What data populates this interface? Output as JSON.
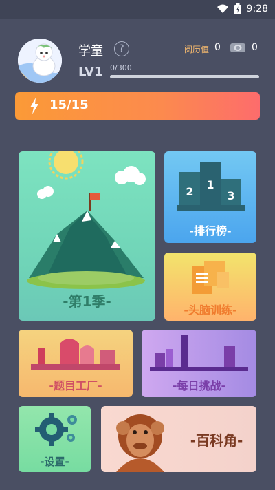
{
  "status_bar": {
    "time": "9:28"
  },
  "profile": {
    "name": "学童",
    "help_symbol": "?",
    "experience_label": "阅历值",
    "experience_value": "0",
    "coins_value": "0",
    "level": "LV1",
    "exp_text": "0/300",
    "exp_progress": 0
  },
  "energy": {
    "text": "15/15"
  },
  "cards": {
    "season": {
      "label": "-第1季-"
    },
    "leaderboard": {
      "label": "-排行榜-",
      "podium": [
        "2",
        "1",
        "3"
      ]
    },
    "brain_training": {
      "label": "-头脑训练-"
    },
    "question_factory": {
      "label": "-题目工厂-"
    },
    "daily_challenge": {
      "label": "-每日挑战-"
    },
    "settings": {
      "label": "-设置-"
    },
    "encyclopedia": {
      "label": "-百科角-"
    }
  },
  "colors": {
    "background": "#4a4f63",
    "energy_start": "#fb9a37",
    "energy_end": "#fd6c6c",
    "experience_label": "#f4b86e"
  },
  "icons": [
    "wifi-icon",
    "battery-icon",
    "help-icon",
    "coin-icon",
    "lightning-icon",
    "gear-icon"
  ]
}
